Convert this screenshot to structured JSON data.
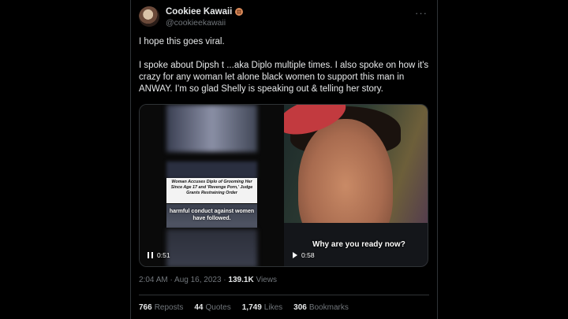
{
  "author": {
    "display_name": "Cookiee Kawaii",
    "handle": "@cookieekawaii",
    "badge_icon": "cookie-emoji-icon"
  },
  "post": {
    "paragraphs": [
      "I hope this goes viral.",
      "I spoke about Dipsh t ...aka Diplo multiple times. I also spoke on how it's crazy for any woman let alone black women to support this man in ANWAY.  I'm so glad Shelly is speaking out & telling her story."
    ],
    "timestamp": "2:04 AM · Aug 16, 2023 · ",
    "views_count": "139.1K",
    "views_label": " Views"
  },
  "media": {
    "left_video": {
      "headline": "Woman Accuses Diplo of Grooming Her Since Age 17 and 'Revenge Porn,' Judge Grants Restraining Order",
      "caption": "harmful conduct against women have followed.",
      "duration": "0:51",
      "state": "playing"
    },
    "right_video": {
      "subtitle": "Why are you ready now?",
      "duration": "0:58",
      "state": "paused"
    }
  },
  "stats": {
    "reposts_count": "766",
    "reposts_label": "Reposts",
    "quotes_count": "44",
    "quotes_label": "Quotes",
    "likes_count": "1,749",
    "likes_label": "Likes",
    "bookmarks_count": "306",
    "bookmarks_label": "Bookmarks"
  },
  "colors": {
    "background": "#000000",
    "text": "#e7e9ea",
    "muted": "#71767b",
    "border": "#2f3336"
  }
}
